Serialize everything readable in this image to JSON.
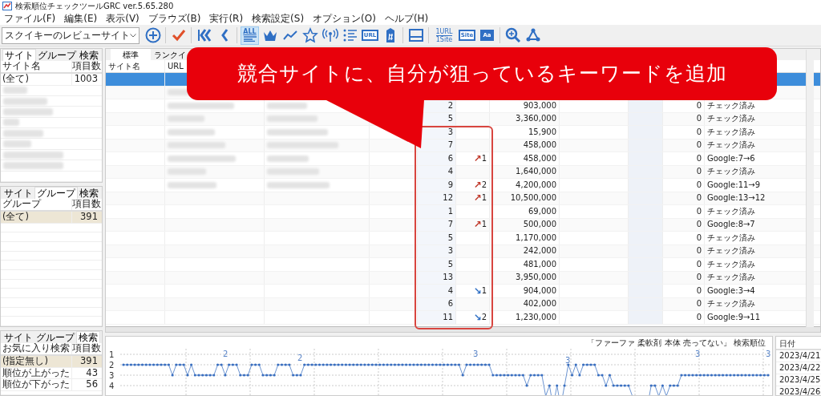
{
  "window": {
    "title": "検索順位チェックツールGRC  ver.5.65.280"
  },
  "menu": [
    "ファイル(F)",
    "編集(E)",
    "表示(V)",
    "ブラウズ(B)",
    "実行(R)",
    "検索設定(S)",
    "オプション(O)",
    "ヘルプ(H)"
  ],
  "site_select": {
    "value": "スクイキーのレビューサイト"
  },
  "toolbar": [
    {
      "selected": false
    },
    {
      "selected": false
    },
    {
      "selected": false
    },
    {
      "selected": false
    },
    {
      "label": "ALL",
      "selected": true
    },
    {
      "selected": false
    },
    {
      "selected": false
    },
    {
      "selected": false
    },
    {
      "selected": false
    },
    {
      "selected": false
    },
    {
      "label": "URL",
      "selected": false
    },
    {
      "selected": false
    },
    {
      "selected": false
    },
    {
      "label": "1URL",
      "label_2": "1Site",
      "selected": false
    },
    {
      "label": "Site",
      "selected": false
    },
    {
      "label": "Aa",
      "selected": false
    },
    {
      "selected": false
    },
    {
      "selected": false
    }
  ],
  "side_panels": [
    {
      "tabs": [
        {
          "label": "サイト",
          "selected": true
        },
        {
          "label": "グループ",
          "selected": false
        },
        {
          "label": "検索",
          "selected": false
        }
      ],
      "columns": [
        "サイト名",
        "項目数"
      ],
      "rows": [
        {
          "name": "(全て)",
          "count": "1003",
          "selected": false
        }
      ],
      "blurred_rows": true
    },
    {
      "tabs": [
        {
          "label": "サイト",
          "selected": false
        },
        {
          "label": "グループ",
          "selected": true
        },
        {
          "label": "検索",
          "selected": false
        }
      ],
      "columns": [
        "グループ",
        "項目数"
      ],
      "rows": [
        {
          "name": "(全て)",
          "count": "391",
          "selected": true
        }
      ],
      "blurred_rows": false
    },
    {
      "tabs": [
        {
          "label": "サイト",
          "selected": false
        },
        {
          "label": "グループ",
          "selected": false
        },
        {
          "label": "検索",
          "selected": true
        }
      ],
      "columns": [
        "お気に入り検索",
        "項目数"
      ],
      "rows": [
        {
          "name": "(指定無し)",
          "count": "391",
          "selected": true
        },
        {
          "name": "順位が上がった",
          "count": "43",
          "selected": false
        },
        {
          "name": "順位が下がった",
          "count": "56",
          "selected": false
        }
      ],
      "blurred_rows": false
    }
  ],
  "main": {
    "tabs": [
      {
        "label": "標準",
        "selected": true
      },
      {
        "label": "ランクイ",
        "selected": false
      }
    ],
    "columns": [
      "サイト名",
      "URL"
    ],
    "rows": [
      {
        "selected": true
      },
      {
        "selected": false
      },
      {
        "selected": false,
        "rank": "2",
        "volume": "903,000",
        "count": "0",
        "status": "チェック済み"
      },
      {
        "selected": false,
        "rank": "5",
        "volume": "3,360,000",
        "count": "0",
        "status": "チェック済み"
      },
      {
        "selected": false,
        "rank": "3",
        "volume": "15,900",
        "count": "0",
        "status": "チェック済み"
      },
      {
        "selected": false,
        "rank": "7",
        "volume": "458,000",
        "count": "0",
        "status": "チェック済み"
      },
      {
        "selected": false,
        "rank": "6",
        "change": {
          "arrow": "↗",
          "amount": "1",
          "color": "#c0392b"
        },
        "volume": "458,000",
        "count": "0",
        "status": "Google:7→6"
      },
      {
        "selected": false,
        "rank": "4",
        "volume": "1,640,000",
        "count": "0",
        "status": "チェック済み"
      },
      {
        "selected": false,
        "rank": "9",
        "change": {
          "arrow": "↗",
          "amount": "2",
          "color": "#c0392b"
        },
        "volume": "4,200,000",
        "count": "0",
        "status": "Google:11→9"
      },
      {
        "selected": false,
        "rank": "12",
        "change": {
          "arrow": "↗",
          "amount": "1",
          "color": "#c0392b"
        },
        "volume": "10,500,000",
        "count": "0",
        "status": "Google:13→12"
      },
      {
        "selected": false,
        "rank": "1",
        "volume": "69,000",
        "count": "0",
        "status": "チェック済み"
      },
      {
        "selected": false,
        "rank": "7",
        "change": {
          "arrow": "↗",
          "amount": "1",
          "color": "#c0392b"
        },
        "volume": "500,000",
        "count": "0",
        "status": "Google:8→7"
      },
      {
        "selected": false,
        "rank": "5",
        "volume": "1,170,000",
        "count": "0",
        "status": "チェック済み"
      },
      {
        "selected": false,
        "rank": "3",
        "volume": "242,000",
        "count": "0",
        "status": "チェック済み"
      },
      {
        "selected": false,
        "rank": "5",
        "volume": "481,000",
        "count": "0",
        "status": "チェック済み"
      },
      {
        "selected": false,
        "rank": "13",
        "volume": "3,950,000",
        "count": "0",
        "status": "チェック済み"
      },
      {
        "selected": false,
        "rank": "4",
        "change": {
          "arrow": "↘",
          "amount": "1",
          "color": "#2f6fc4"
        },
        "volume": "904,000",
        "count": "0",
        "status": "Google:3→4"
      },
      {
        "selected": false,
        "rank": "6",
        "volume": "402,000",
        "count": "0",
        "status": "チェック済み"
      },
      {
        "selected": false,
        "rank": "11",
        "change": {
          "arrow": "↘",
          "amount": "2",
          "color": "#2f6fc4"
        },
        "volume": "1,230,000",
        "count": "0",
        "status": "Google:9→11"
      }
    ]
  },
  "rank_chart": {
    "title": "「ファーファ 柔軟剤 本体 売ってない」 検索順位",
    "axis_labels": [
      "1",
      "2",
      "3",
      "4"
    ],
    "point_labels": [
      "2",
      "2",
      "3",
      "3",
      "3",
      "3"
    ]
  },
  "date_panel": {
    "header": "日付",
    "rows": [
      "2023/4/21",
      "2023/4/22",
      "2023/4/25",
      "2023/4/26"
    ]
  },
  "annotation": {
    "callout": "競合サイトに、自分が狙っているキーワードを追加",
    "highlight_frame": true
  }
}
